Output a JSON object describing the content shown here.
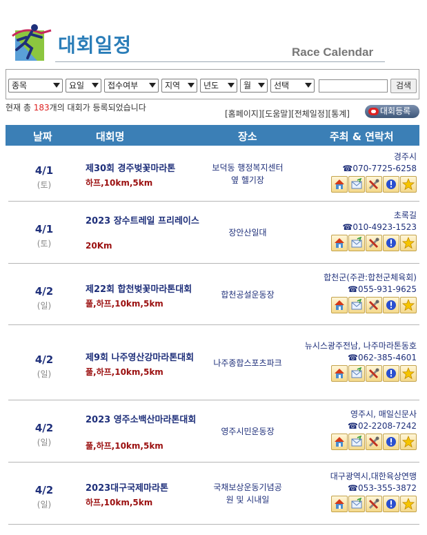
{
  "header": {
    "title": "대회일정",
    "subtitle": "Race Calendar"
  },
  "search": {
    "selects": [
      {
        "label": "종목"
      },
      {
        "label": "요일"
      },
      {
        "label": "접수여부"
      },
      {
        "label": "지역"
      },
      {
        "label": "년도"
      },
      {
        "label": "월"
      },
      {
        "label": "선택"
      }
    ],
    "input_value": "",
    "button_label": "검색"
  },
  "status": {
    "prefix": "현재 총 ",
    "count": "183",
    "suffix": "개의 대회가 등록되었습니다"
  },
  "links": {
    "home": "[홈페이지]",
    "help": "[도움말]",
    "all": "[전체일정]",
    "stats": "[통계]",
    "register": "대회등록"
  },
  "table": {
    "headers": {
      "date": "날짜",
      "name": "대회명",
      "place": "장소",
      "host": "주최 & 연락처"
    },
    "phone_symbol": "☎",
    "rows": [
      {
        "date": "4/1",
        "day": "(토)",
        "name": "제30회 경주벚꽃마라톤",
        "distance": "하프,10km,5km",
        "place": "보덕동 행정복지센터 옆 헬기장",
        "host": "경주시",
        "phone": "070-7725-6258"
      },
      {
        "date": "4/1",
        "day": "(토)",
        "name": "2023 장수트레일 프리레이스",
        "distance": "20Km",
        "place": "장안산일대",
        "host": "초록길",
        "phone": "010-4923-1523"
      },
      {
        "date": "4/2",
        "day": "(일)",
        "name": "제22회 합천벚꽃마라톤대회",
        "distance": "풀,하프,10km,5km",
        "place": "합천공설운동장",
        "host": "합천군(주관:합천군체육회)",
        "phone": "055-931-9625"
      },
      {
        "date": "4/2",
        "day": "(일)",
        "name": "제9회 나주영산강마라톤대회",
        "distance": "풀,하프,10km,5km",
        "place": "나주종합스포츠파크",
        "host": "뉴시스광주전남, 나주마라톤동호",
        "phone": "062-385-4601"
      },
      {
        "date": "4/2",
        "day": "(일)",
        "name": "2023 영주소백산마라톤대회",
        "distance": "풀,하프,10km,5km",
        "place": "영주시민운동장",
        "host": "영주시, 매일신문사",
        "phone": "02-2208-7242"
      },
      {
        "date": "4/2",
        "day": "(일)",
        "name": "2023대구국제마라톤",
        "distance": "하프,10km,5km",
        "place": "국채보상운동기념공원 및 시내일",
        "host": "대구광역시,대한육상연맹",
        "phone": "053-355-3872"
      }
    ]
  },
  "row_icons": [
    "home-icon",
    "mail-icon",
    "tools-icon",
    "info-icon",
    "star-icon"
  ],
  "colors": {
    "brand_blue": "#2a7db8",
    "table_header": "#3b7fb6",
    "name_navy": "#1e2f7a",
    "distance_red": "#9b1010",
    "count_red": "#dd2222"
  }
}
